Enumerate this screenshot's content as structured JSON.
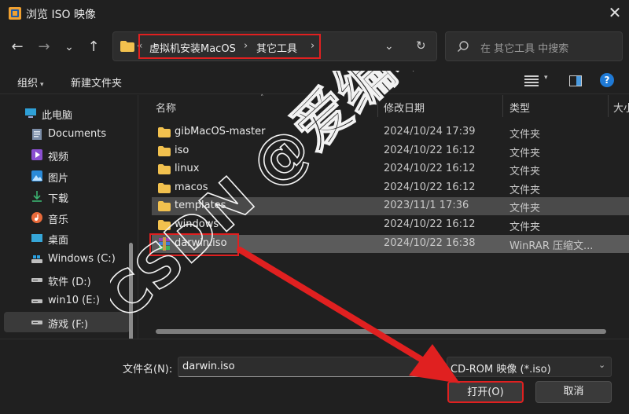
{
  "window": {
    "title": "浏览 ISO 映像",
    "close_glyph": "✕"
  },
  "nav": {
    "back": "←",
    "forward": "→",
    "recent": "⌄",
    "up": "↑"
  },
  "address": {
    "crumbs": [
      "虚拟机安装MacOS",
      "其它工具"
    ],
    "separator": "›",
    "leading_chevron": "«",
    "dropdown_glyph": "⌄",
    "refresh_glyph": "↻"
  },
  "search": {
    "placeholder": "在 其它工具 中搜索"
  },
  "toolbar": {
    "organize": "组织",
    "new_folder": "新建文件夹",
    "help": "?",
    "caret": "▾"
  },
  "sidebar": {
    "items": [
      {
        "label": "此电脑",
        "icon": "computer-icon"
      },
      {
        "label": "Documents",
        "icon": "documents-icon"
      },
      {
        "label": "视频",
        "icon": "video-icon"
      },
      {
        "label": "图片",
        "icon": "pictures-icon"
      },
      {
        "label": "下载",
        "icon": "download-icon"
      },
      {
        "label": "音乐",
        "icon": "music-icon"
      },
      {
        "label": "桌面",
        "icon": "desktop-icon"
      },
      {
        "label": "Windows (C:)",
        "icon": "drive-c-icon"
      },
      {
        "label": "软件 (D:)",
        "icon": "drive-icon"
      },
      {
        "label": "win10 (E:)",
        "icon": "drive-icon"
      },
      {
        "label": "游戏 (F:)",
        "icon": "drive-icon"
      }
    ],
    "selected_index": 10
  },
  "columns": {
    "name": "名称",
    "modified": "修改日期",
    "type": "类型",
    "size": "大小",
    "sort_glyph": "˄"
  },
  "files": [
    {
      "name": "gibMacOS-master",
      "date": "2024/10/24 17:39",
      "type": "文件夹",
      "icon": "folder-icon"
    },
    {
      "name": "iso",
      "date": "2024/10/22 16:12",
      "type": "文件夹",
      "icon": "folder-icon"
    },
    {
      "name": "linux",
      "date": "2024/10/22 16:12",
      "type": "文件夹",
      "icon": "folder-icon"
    },
    {
      "name": "macos",
      "date": "2024/10/22 16:12",
      "type": "文件夹",
      "icon": "folder-icon"
    },
    {
      "name": "templates",
      "date": "2023/11/1 17:36",
      "type": "文件夹",
      "icon": "folder-icon"
    },
    {
      "name": "windows",
      "date": "2024/10/22 16:12",
      "type": "文件夹",
      "icon": "folder-icon"
    },
    {
      "name": "darwin.iso",
      "date": "2024/10/22 16:38",
      "type": "WinRAR 压缩文...",
      "icon": "winrar-archive-icon"
    }
  ],
  "hover_row": 4,
  "selected_row": 6,
  "footer": {
    "filename_label": "文件名(N):",
    "filename_value": "darwin.iso",
    "filter_value": "CD-ROM 映像 (*.iso)",
    "filter_caret": "⌄",
    "open_label": "打开(O)",
    "cancel_label": "取消"
  },
  "overlay": {
    "watermark_logo": "CSDN @爱编软件"
  },
  "colors": {
    "highlight_red": "#e02020",
    "folder_yellow": "#f2c14e",
    "accent_blue": "#1f7ad6"
  }
}
